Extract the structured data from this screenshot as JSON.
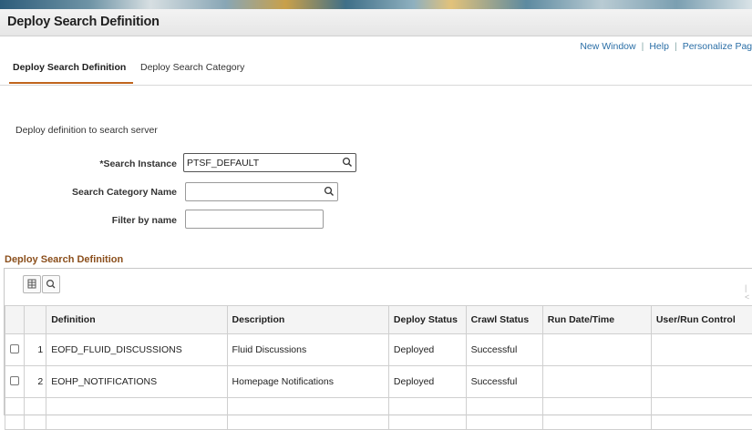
{
  "page": {
    "title": "Deploy Search Definition"
  },
  "top_links": [
    "New Window",
    "Help",
    "Personalize Page"
  ],
  "tabs": [
    {
      "label": "Deploy Search Definition",
      "active": true
    },
    {
      "label": "Deploy Search Category",
      "active": false
    }
  ],
  "intro": "Deploy definition to search server",
  "form": {
    "search_instance": {
      "label": "*Search Instance",
      "value": "PTSF_DEFAULT"
    },
    "search_category": {
      "label": "Search Category Name",
      "value": ""
    },
    "filter": {
      "label": "Filter by name",
      "value": ""
    }
  },
  "grid": {
    "title": "Deploy Search Definition",
    "columns": [
      "",
      "",
      "Definition",
      "Description",
      "Deploy Status",
      "Crawl Status",
      "Run Date/Time",
      "User/Run Control"
    ],
    "rows": [
      {
        "num": "1",
        "definition": "EOFD_FLUID_DISCUSSIONS",
        "description": "Fluid Discussions",
        "deploy_status": "Deployed",
        "crawl_status": "Successful",
        "run_date": "",
        "user_run_control": ""
      },
      {
        "num": "2",
        "definition": "EOHP_NOTIFICATIONS",
        "description": "Homepage Notifications",
        "deploy_status": "Deployed",
        "crawl_status": "Successful",
        "run_date": "",
        "user_run_control": ""
      }
    ]
  },
  "icons": {
    "lookup": "magnifier-icon",
    "grid_settings": "grid-settings-icon",
    "grid_find": "search-icon"
  },
  "colors": {
    "link": "#2a6ea6",
    "section_title": "#8b4f1c",
    "tab_underline": "#c0651d"
  }
}
